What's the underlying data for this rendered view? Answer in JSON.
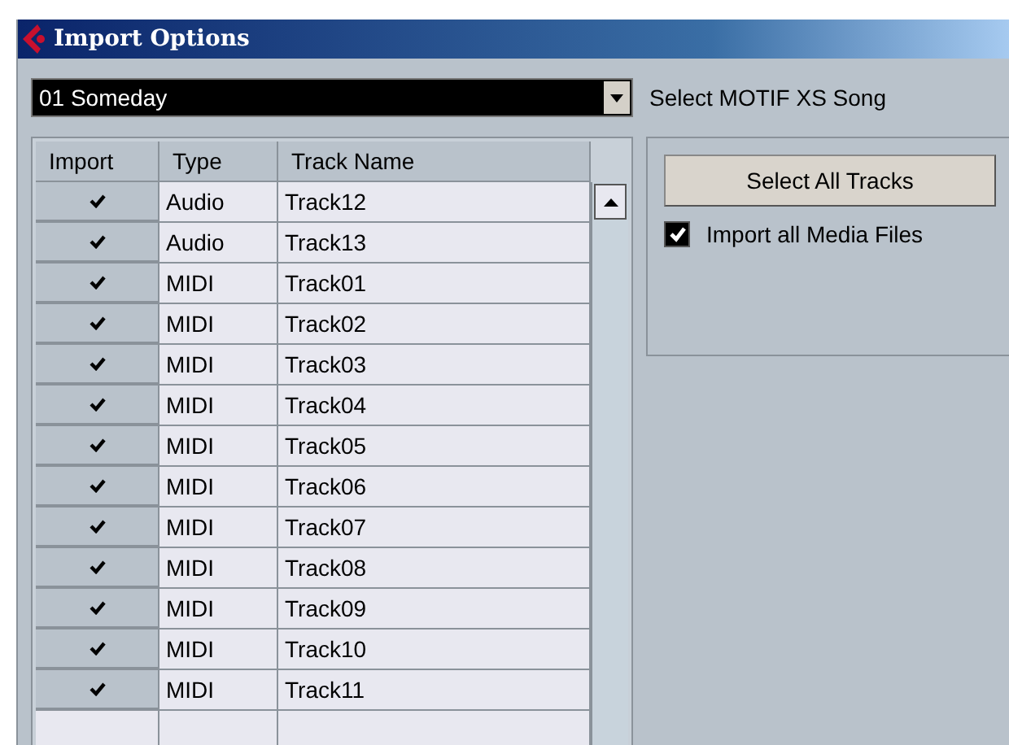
{
  "window": {
    "title": "Import Options"
  },
  "song_select": {
    "value": "01 Someday",
    "label": "Select MOTIF XS Song"
  },
  "table": {
    "columns": [
      "Import",
      "Type",
      "Track Name"
    ],
    "rows": [
      {
        "checked": true,
        "type": "Audio",
        "name": "Track12"
      },
      {
        "checked": true,
        "type": "Audio",
        "name": "Track13"
      },
      {
        "checked": true,
        "type": "MIDI",
        "name": "Track01"
      },
      {
        "checked": true,
        "type": "MIDI",
        "name": "Track02"
      },
      {
        "checked": true,
        "type": "MIDI",
        "name": "Track03"
      },
      {
        "checked": true,
        "type": "MIDI",
        "name": "Track04"
      },
      {
        "checked": true,
        "type": "MIDI",
        "name": "Track05"
      },
      {
        "checked": true,
        "type": "MIDI",
        "name": "Track06"
      },
      {
        "checked": true,
        "type": "MIDI",
        "name": "Track07"
      },
      {
        "checked": true,
        "type": "MIDI",
        "name": "Track08"
      },
      {
        "checked": true,
        "type": "MIDI",
        "name": "Track09"
      },
      {
        "checked": true,
        "type": "MIDI",
        "name": "Track10"
      },
      {
        "checked": true,
        "type": "MIDI",
        "name": "Track11"
      }
    ]
  },
  "select_all_button": "Select All Tracks",
  "import_media": {
    "label": "Import all Media Files",
    "checked": true
  }
}
